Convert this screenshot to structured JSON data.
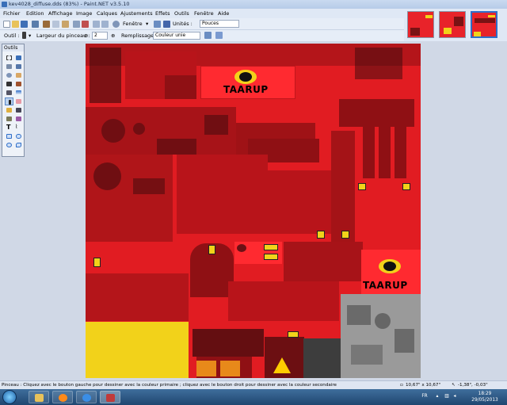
{
  "window": {
    "title": "kev4028_diffuse.dds (83%) - Paint.NET v3.5.10"
  },
  "menu": {
    "items": [
      "Fichier",
      "Edition",
      "Affichage",
      "Image",
      "Calques",
      "Ajustements",
      "Effets",
      "Outils",
      "Fenêtre",
      "Aide"
    ]
  },
  "toolbar": {
    "window_label": "Fenêtre",
    "units_label": "Unités :",
    "units_value": "Pouces",
    "tool_label": "Outil :",
    "brush_width_label": "Largeur du pinceau :",
    "brush_width_value": "2",
    "fill_label": "Remplissage :",
    "fill_value": "Couleur unie"
  },
  "tools_window": {
    "title": "Outils"
  },
  "canvas": {
    "logo_text_top": "TAARUP",
    "logo_text_bottom": "TAARUP"
  },
  "status": {
    "message": "Pinceau : Cliquez avec le bouton gauche pour dessiner avec la couleur primaire ; cliquez avec le bouton droit pour dessiner avec la couleur secondaire",
    "image_size": "10,67\" x 10,67\"",
    "cursor_position": "-1,38\", -0,03\""
  },
  "taskbar": {
    "language": "FR",
    "time": "18:29",
    "date": "29/05/2013"
  },
  "colors": {
    "canvas_red": "#e11c22",
    "logo_yellow": "#f2d21a",
    "accent_blue": "#2f6ec8"
  }
}
